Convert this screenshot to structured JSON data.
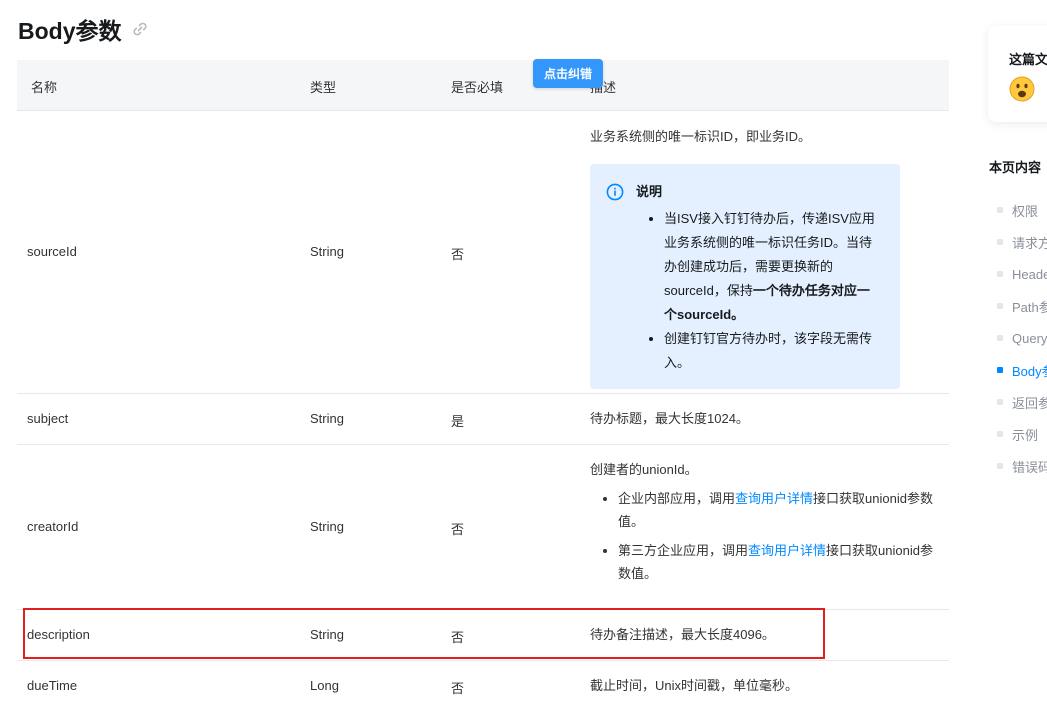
{
  "heading": {
    "title": "Body参数"
  },
  "fix_button": "点击纠错",
  "table": {
    "headers": [
      "名称",
      "类型",
      "是否必填",
      "描述"
    ],
    "rows": [
      {
        "name": "sourceId",
        "type": "String",
        "required": "否",
        "desc": "业务系统侧的唯一标识ID，即业务ID。",
        "note": {
          "title": "说明",
          "items": [
            {
              "text": "当ISV接入钉钉待办后，传递ISV应用业务系统侧的唯一标识任务ID。当待办创建成功后，需要更换新的sourceId，保持",
              "bold": "一个待办任务对应一个sourceId。"
            },
            {
              "text": "创建钉钉官方待办时，该字段无需传入。"
            }
          ]
        }
      },
      {
        "name": "subject",
        "type": "String",
        "required": "是",
        "desc": "待办标题，最大长度1024。"
      },
      {
        "name": "creatorId",
        "type": "String",
        "required": "否",
        "desc": "创建者的unionId。",
        "items": [
          {
            "pre": "企业内部应用，调用",
            "link": "查询用户详情",
            "post": "接口获取unionid参数值。"
          },
          {
            "pre": "第三方企业应用，调用",
            "link": "查询用户详情",
            "post": "接口获取unionid参数值。"
          }
        ]
      },
      {
        "name": "description",
        "type": "String",
        "required": "否",
        "desc": "待办备注描述，最大长度4096。"
      },
      {
        "name": "dueTime",
        "type": "Long",
        "required": "否",
        "desc": "截止时间，Unix时间戳，单位毫秒。"
      }
    ]
  },
  "sidebar": {
    "card_title": "这篇文",
    "toc_title": "本页内容",
    "toc": [
      "权限",
      "请求方",
      "Heade",
      "Path参",
      "Query",
      "Body参",
      "返回参",
      "示例",
      "错误码"
    ],
    "active_index": 5
  },
  "colors": {
    "accent": "#0089ff",
    "highlight": "#e02020",
    "note_bg": "#e4f0ff",
    "button": "#3296fa"
  }
}
